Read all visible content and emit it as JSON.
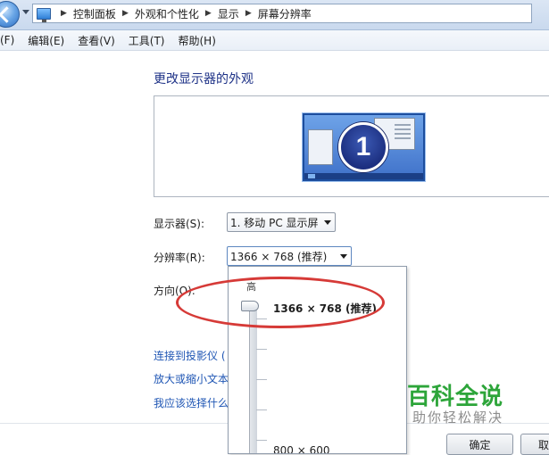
{
  "address_bar": {
    "breadcrumbs": [
      "控制面板",
      "外观和个性化",
      "显示",
      "屏幕分辨率"
    ]
  },
  "menu": {
    "items": [
      "(F)",
      "编辑(E)",
      "查看(V)",
      "工具(T)",
      "帮助(H)"
    ]
  },
  "page": {
    "title": "更改显示器的外观",
    "monitor_number": "1"
  },
  "form": {
    "display_label": "显示器(S):",
    "display_value": "1. 移动 PC 显示屏",
    "resolution_label": "分辨率(R):",
    "resolution_value": "1366 × 768 (推荐)",
    "orientation_label": "方向(O):"
  },
  "links": [
    "连接到投影仪 (",
    "放大或缩小文本",
    "我应该选择什么"
  ],
  "resolution_dropdown": {
    "high_label": "高",
    "selected": "1366 × 768 (推荐)",
    "low_value": "800 × 600",
    "slider_level": 1.0
  },
  "watermark": {
    "title": "百科全说",
    "subtitle": "助你轻松解决"
  },
  "buttons": {
    "ok": "确定",
    "cancel": "取"
  },
  "colors": {
    "title_blue": "#1e3287",
    "link_blue": "#1f56b4",
    "annotation_red": "#d63a37",
    "watermark_green": "#2da53a"
  }
}
